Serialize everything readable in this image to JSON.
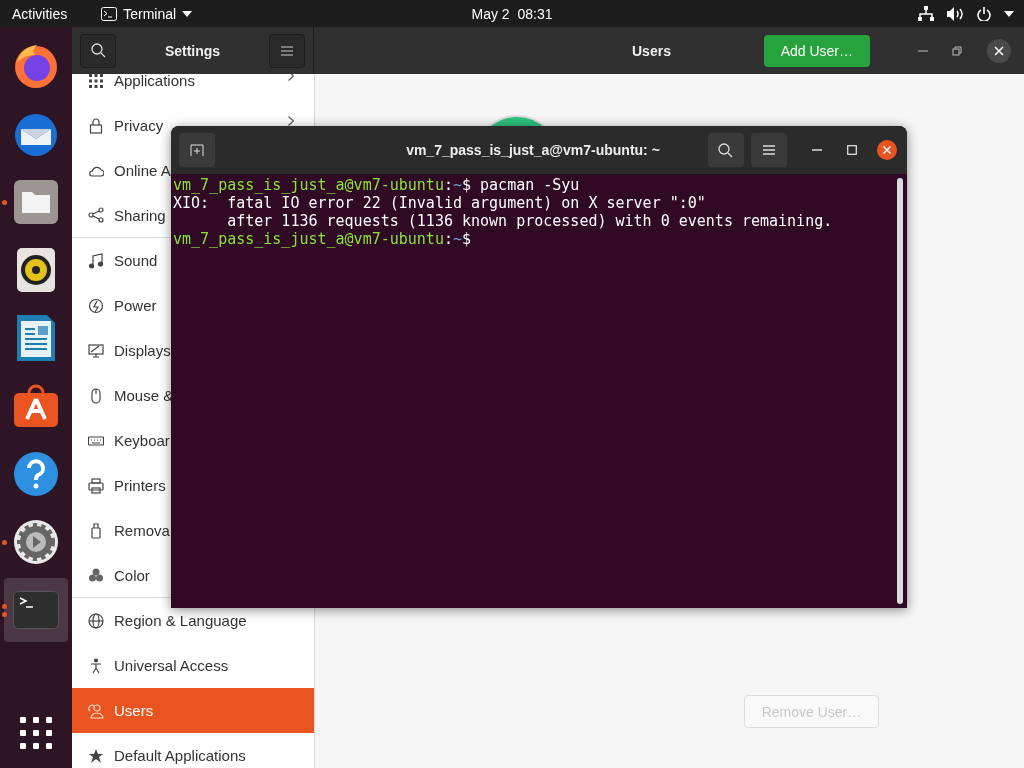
{
  "top_bar": {
    "activities": "Activities",
    "app_menu": "Terminal",
    "clock": "May 2  08:31"
  },
  "dock": [
    {
      "kind": "firefox",
      "running": false,
      "active": false
    },
    {
      "kind": "thunderbird",
      "running": false,
      "active": false
    },
    {
      "kind": "files",
      "running": true,
      "active": false
    },
    {
      "kind": "rhythmbox",
      "running": false,
      "active": false
    },
    {
      "kind": "writer",
      "running": false,
      "active": false
    },
    {
      "kind": "software",
      "running": false,
      "active": false
    },
    {
      "kind": "help",
      "running": false,
      "active": false
    },
    {
      "kind": "settings",
      "running": true,
      "active": false
    },
    {
      "kind": "terminal",
      "running": true,
      "active": true
    }
  ],
  "settings": {
    "title": "Settings",
    "page_title": "Users",
    "add_button": "Add User…",
    "remove_button": {
      "label": "Remove User…",
      "disabled": true
    },
    "sidebar": [
      {
        "label": "Applications",
        "chevron": true,
        "separator_after": false,
        "selected": false
      },
      {
        "label": "Privacy",
        "chevron": true,
        "separator_after": false,
        "selected": false
      },
      {
        "label": "Online A",
        "chevron": false,
        "separator_after": false,
        "selected": false
      },
      {
        "label": "Sharing",
        "chevron": false,
        "separator_after": true,
        "selected": false
      },
      {
        "label": "Sound",
        "chevron": false,
        "separator_after": false,
        "selected": false
      },
      {
        "label": "Power",
        "chevron": false,
        "separator_after": false,
        "selected": false
      },
      {
        "label": "Displays",
        "chevron": false,
        "separator_after": false,
        "selected": false
      },
      {
        "label": "Mouse &",
        "chevron": false,
        "separator_after": false,
        "selected": false
      },
      {
        "label": "Keyboar",
        "chevron": false,
        "separator_after": false,
        "selected": false
      },
      {
        "label": "Printers",
        "chevron": false,
        "separator_after": false,
        "selected": false
      },
      {
        "label": "Remova",
        "chevron": false,
        "separator_after": false,
        "selected": false
      },
      {
        "label": "Color",
        "chevron": false,
        "separator_after": true,
        "selected": false
      },
      {
        "label": "Region & Language",
        "chevron": false,
        "separator_after": false,
        "selected": false
      },
      {
        "label": "Universal Access",
        "chevron": false,
        "separator_after": false,
        "selected": false
      },
      {
        "label": "Users",
        "chevron": false,
        "separator_after": false,
        "selected": true
      },
      {
        "label": "Default Applications",
        "chevron": false,
        "separator_after": false,
        "selected": false
      }
    ]
  },
  "terminal": {
    "title": "vm_7_pass_is_just_a@vm7-ubuntu: ~",
    "lines": [
      {
        "segments": [
          {
            "kind": "user",
            "text": "vm_7_pass_is_just_a@vm7-ubuntu"
          },
          {
            "kind": "plain",
            "text": ":"
          },
          {
            "kind": "path",
            "text": "~"
          },
          {
            "kind": "plain",
            "text": "$ pacman -Syu"
          }
        ]
      },
      {
        "segments": [
          {
            "kind": "plain",
            "text": "XIO:  fatal IO error 22 (Invalid argument) on X server \":0\""
          }
        ]
      },
      {
        "segments": [
          {
            "kind": "plain",
            "text": "      after 1136 requests (1136 known processed) with 0 events remaining."
          }
        ]
      },
      {
        "segments": [
          {
            "kind": "user",
            "text": "vm_7_pass_is_just_a@vm7-ubuntu"
          },
          {
            "kind": "plain",
            "text": ":"
          },
          {
            "kind": "path",
            "text": "~"
          },
          {
            "kind": "plain",
            "text": "$"
          }
        ]
      }
    ]
  }
}
